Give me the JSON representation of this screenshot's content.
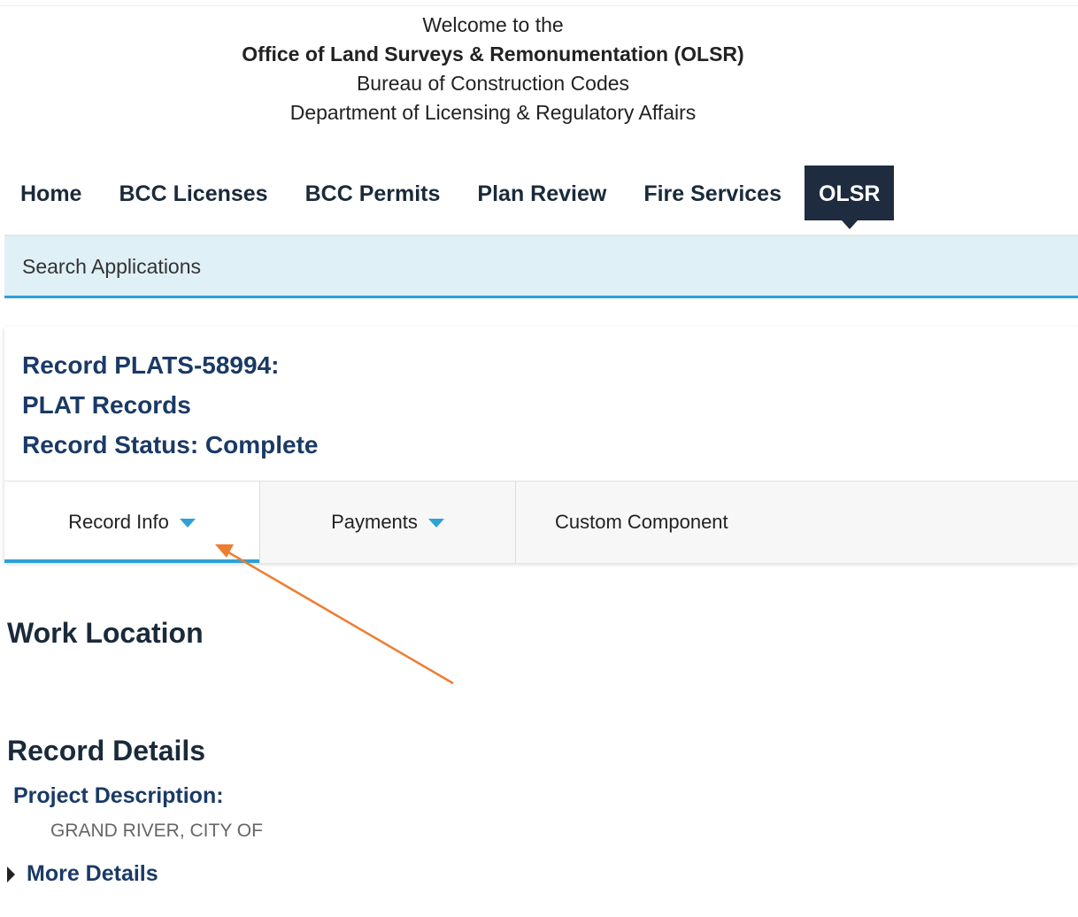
{
  "header": {
    "line1": "Welcome to the",
    "line2": "Office of Land Surveys & Remonumentation (OLSR)",
    "line3": "Bureau of Construction Codes",
    "line4": "Department of Licensing & Regulatory Affairs"
  },
  "nav": {
    "items": [
      {
        "label": "Home"
      },
      {
        "label": "BCC Licenses"
      },
      {
        "label": "BCC Permits"
      },
      {
        "label": "Plan Review"
      },
      {
        "label": "Fire Services"
      },
      {
        "label": "OLSR",
        "active": true
      }
    ]
  },
  "subnav": {
    "search_label": "Search Applications"
  },
  "record": {
    "id_line": "Record PLATS-58994:",
    "type_line": "PLAT Records",
    "status_line": "Record Status: Complete"
  },
  "tabs": [
    {
      "label": "Record Info",
      "active": true,
      "has_dropdown": true
    },
    {
      "label": "Payments",
      "has_dropdown": true
    },
    {
      "label": "Custom Component"
    }
  ],
  "sections": {
    "work_location_title": "Work Location",
    "record_details_title": "Record Details",
    "project_description_label": "Project Description:",
    "project_description_value": "GRAND RIVER, CITY OF",
    "more_details_label": "More Details"
  },
  "colors": {
    "accent": "#2ea1d6",
    "nav_active_bg": "#1f2b3e",
    "heading_blue": "#1a3a66",
    "search_bar_bg": "#dff0f7",
    "annotation_arrow": "#ed7d31"
  }
}
